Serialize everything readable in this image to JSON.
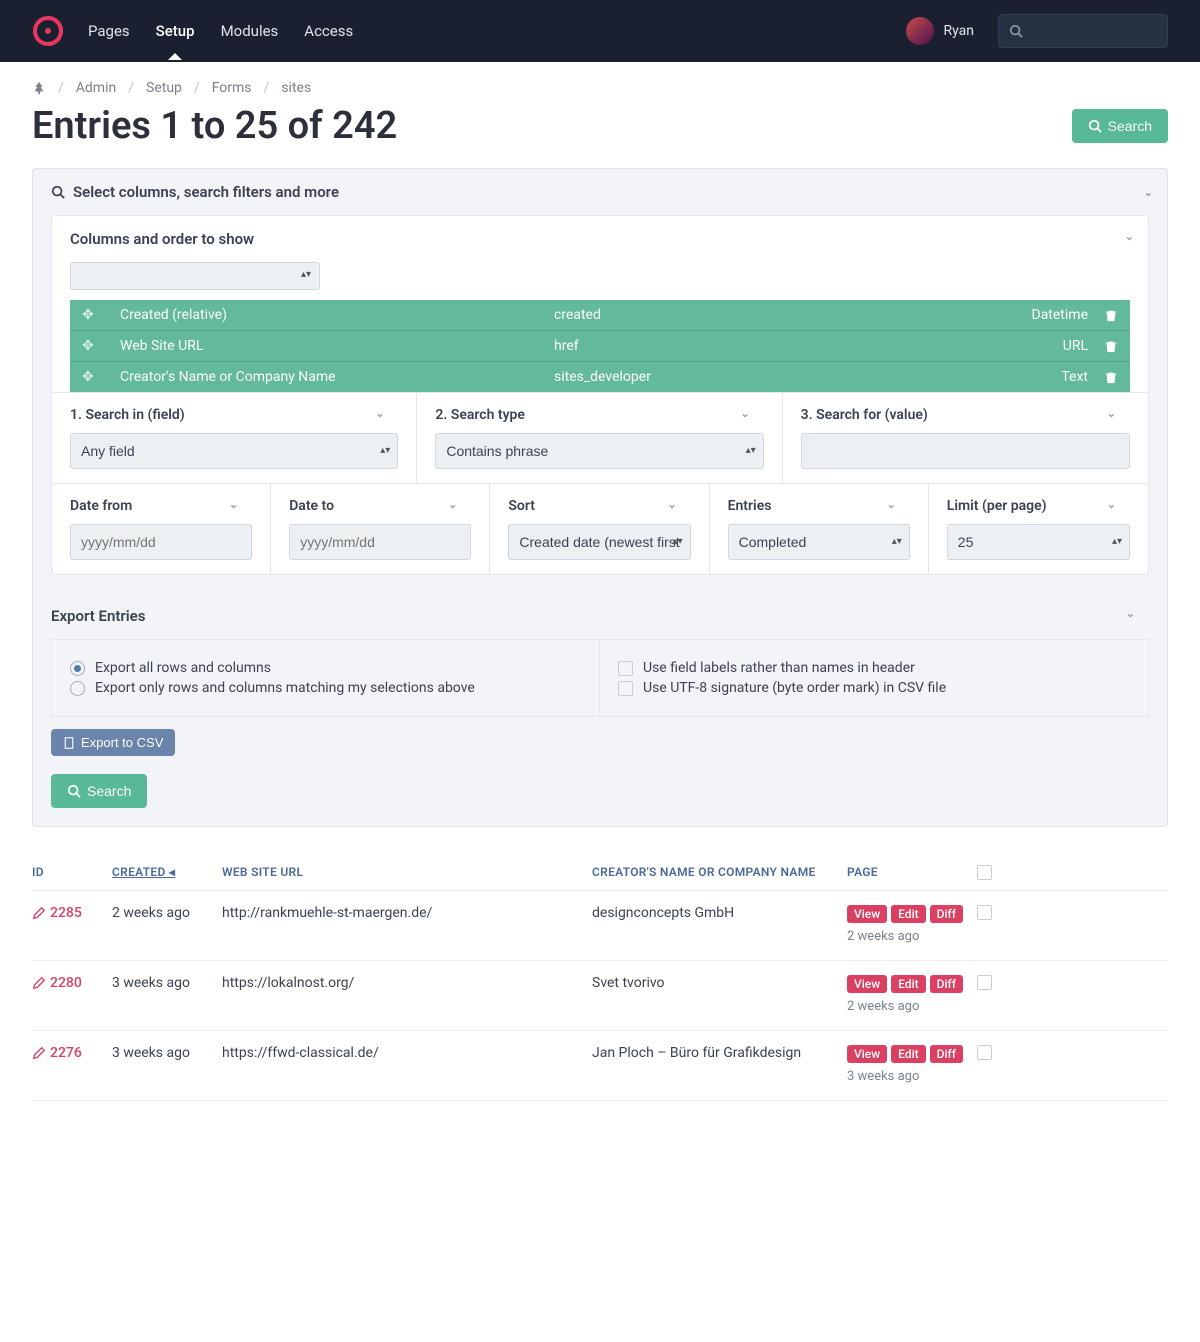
{
  "nav": {
    "items": [
      "Pages",
      "Setup",
      "Modules",
      "Access"
    ],
    "active": 1,
    "user": "Ryan"
  },
  "breadcrumbs": [
    "Admin",
    "Setup",
    "Forms",
    "sites"
  ],
  "title": "Entries 1 to 25 of 242",
  "search_btn": "Search",
  "filter_head": "Select columns, search filters and more",
  "columns": {
    "head": "Columns and order to show",
    "rows": [
      {
        "label": "Created (relative)",
        "field": "created",
        "type": "Datetime"
      },
      {
        "label": "Web Site URL",
        "field": "href",
        "type": "URL"
      },
      {
        "label": "Creator's Name or Company Name",
        "field": "sites_developer",
        "type": "Text"
      }
    ]
  },
  "search_panels": {
    "field": {
      "label": "1. Search in (field)",
      "value": "Any field"
    },
    "type": {
      "label": "2. Search type",
      "value": "Contains phrase"
    },
    "value": {
      "label": "3. Search for (value)"
    }
  },
  "row2": {
    "date_from": {
      "label": "Date from",
      "placeholder": "yyyy/mm/dd"
    },
    "date_to": {
      "label": "Date to",
      "placeholder": "yyyy/mm/dd"
    },
    "sort": {
      "label": "Sort",
      "value": "Created date (newest first)"
    },
    "entries": {
      "label": "Entries",
      "value": "Completed"
    },
    "limit": {
      "label": "Limit (per page)",
      "value": "25"
    }
  },
  "export": {
    "head": "Export Entries",
    "r1": "Export all rows and columns",
    "r2": "Export only rows and columns matching my selections above",
    "c1": "Use field labels rather than names in header",
    "c2": "Use UTF-8 signature (byte order mark) in CSV file",
    "btn": "Export to CSV"
  },
  "table": {
    "headers": {
      "id": "ID",
      "created": "CREATED",
      "url": "WEB SITE URL",
      "creator": "CREATOR'S NAME OR COMPANY NAME",
      "page": "PAGE"
    },
    "rows": [
      {
        "id": "2285",
        "created": "2 weeks ago",
        "url": "http://rankmuehle-st-maergen.de/",
        "creator": "designconcepts GmbH",
        "page_time": "2 weeks ago"
      },
      {
        "id": "2280",
        "created": "3 weeks ago",
        "url": "https://lokalnost.org/",
        "creator": "Svet tvorivo",
        "page_time": "2 weeks ago"
      },
      {
        "id": "2276",
        "created": "3 weeks ago",
        "url": "https://ffwd-classical.de/",
        "creator": "Jan Ploch – Büro für Grafikdesign",
        "page_time": "3 weeks ago"
      }
    ],
    "actions": {
      "view": "View",
      "edit": "Edit",
      "diff": "Diff"
    }
  }
}
